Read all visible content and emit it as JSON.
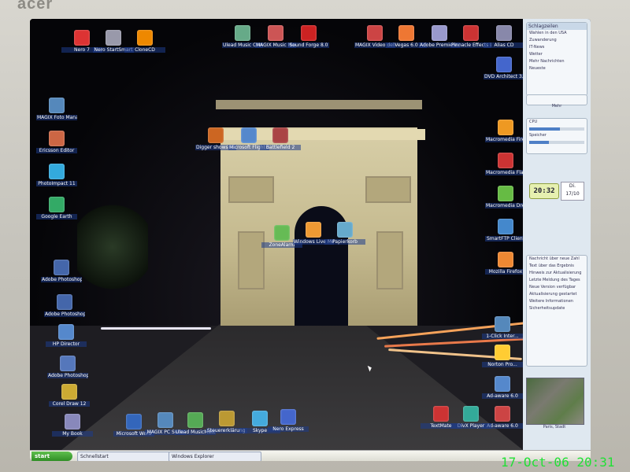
{
  "monitor": {
    "brand": "acer"
  },
  "desktop": {
    "icons": [
      {
        "label": "Nero 7",
        "color": "#d33"
      },
      {
        "label": "Nero StartSmart",
        "color": "#99a"
      },
      {
        "label": "CloneCD",
        "color": "#e80"
      },
      {
        "label": "Ulead Music Con...",
        "color": "#6a8"
      },
      {
        "label": "MAGIX Music Manager",
        "color": "#c55"
      },
      {
        "label": "Sound Forge 8.0",
        "color": "#c22"
      },
      {
        "label": "MAGIX Video deluxe 2006",
        "color": "#c44"
      },
      {
        "label": "Vegas 6.0",
        "color": "#e73"
      },
      {
        "label": "Adobe Premiere ...",
        "color": "#99c"
      },
      {
        "label": "Pinnacle Effects Lab",
        "color": "#c33"
      },
      {
        "label": "Alias CD",
        "color": "#88a"
      },
      {
        "label": "DVD Architect 3.0",
        "color": "#46c"
      },
      {
        "label": "MAGIX Foto Manager",
        "color": "#58b"
      },
      {
        "label": "Ericsson Editor",
        "color": "#c64"
      },
      {
        "label": "PhotoImpact 11",
        "color": "#3ad"
      },
      {
        "label": "Google Earth",
        "color": "#3a6"
      },
      {
        "label": "Adobe Photoshop",
        "color": "#46a"
      },
      {
        "label": "Adobe Photoshop",
        "color": "#46a"
      },
      {
        "label": "HP Director",
        "color": "#58c"
      },
      {
        "label": "Adobe Photoshop ...",
        "color": "#57b"
      },
      {
        "label": "Corel Draw 12",
        "color": "#ca3"
      },
      {
        "label": "My Book",
        "color": "#88b"
      },
      {
        "label": "Microsoft Word",
        "color": "#36b"
      },
      {
        "label": "MAGIX PC Suite",
        "color": "#58b"
      },
      {
        "label": "Ulead MusicMatch",
        "color": "#5a5"
      },
      {
        "label": "Steuererklärung 2005",
        "color": "#b93"
      },
      {
        "label": "Skype",
        "color": "#4ad"
      },
      {
        "label": "Nero Express",
        "color": "#46c"
      },
      {
        "label": "Digger shows a ...",
        "color": "#c62"
      },
      {
        "label": "Microsoft Flight Simula...",
        "color": "#58c"
      },
      {
        "label": "Battlefield 2",
        "color": "#a44"
      },
      {
        "label": "ZoneAlarm",
        "color": "#6b5"
      },
      {
        "label": "Windows Live Messenger",
        "color": "#e93"
      },
      {
        "label": "Papierkorb",
        "color": "#6ac"
      },
      {
        "label": "Macromedia Fireworks 8",
        "color": "#e92"
      },
      {
        "label": "Macromedia Flash 8",
        "color": "#c33"
      },
      {
        "label": "Macromedia Dreamwe...",
        "color": "#6b4"
      },
      {
        "label": "SmartFTP Client",
        "color": "#48c"
      },
      {
        "label": "Mozilla Firefox",
        "color": "#e83"
      },
      {
        "label": "1-Click Inter...",
        "color": "#58b"
      },
      {
        "label": "Norton Pro...",
        "color": "#fc3"
      },
      {
        "label": "Ad-aware 6.0",
        "color": "#58c"
      },
      {
        "label": "Ad-aware 6.0",
        "color": "#c44"
      },
      {
        "label": "DivX Player",
        "color": "#3a9"
      },
      {
        "label": "TextMate",
        "color": "#c33"
      }
    ]
  },
  "sidebar": {
    "feed_title": "Schlagzeilen",
    "feed_lines": [
      "Wahlen in den USA",
      "Zuwanderung",
      "IT-News",
      "Wetter",
      "Mehr Nachrichten",
      "Neueste"
    ],
    "feed_button": "Mehr",
    "meter_labels": [
      "CPU",
      "Speicher"
    ],
    "meter_values": [
      0.55,
      0.35
    ],
    "clock_time": "20:32",
    "clock_day": "Di.",
    "clock_date": "17/10",
    "notes_lines": [
      "Nachricht über neue Zahl",
      "Text über das Ergebnis",
      "Hinweis zur Aktualisierung",
      "Letzte Meldung des Tages",
      "Neue Version verfügbar",
      "Aktualisierung gestartet",
      "Weitere Informationen",
      "Sicherheitsupdate"
    ],
    "map_label": "Paris, Stadt"
  },
  "taskbar": {
    "start_label": "start",
    "tasks": [
      "Schnellstart",
      "Windows Explorer"
    ]
  },
  "camera_timestamp": "17-Oct-06 20:31"
}
